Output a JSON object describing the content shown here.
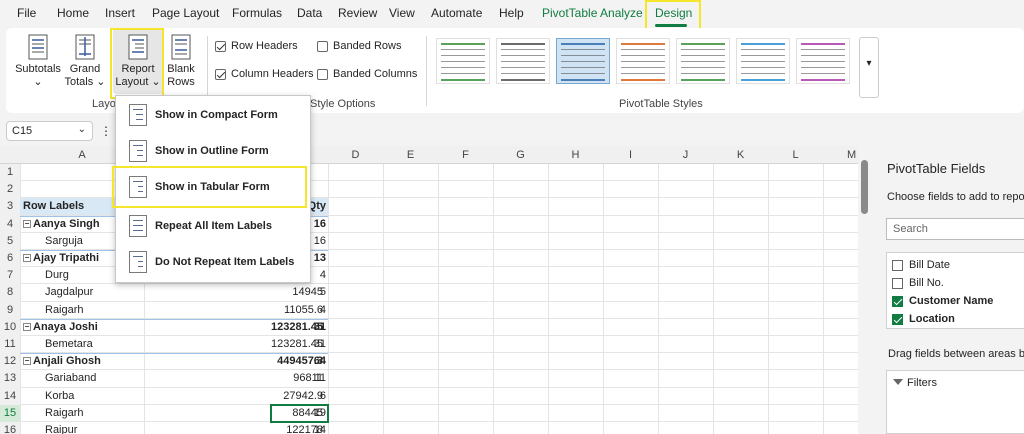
{
  "menu": {
    "tabs": [
      "File",
      "Home",
      "Insert",
      "Page Layout",
      "Formulas",
      "Data",
      "Review",
      "View",
      "Automate",
      "Help",
      "PivotTable Analyze",
      "Design"
    ]
  },
  "ribbon": {
    "subtotals": "Subtotals",
    "grand_totals_1": "Grand",
    "grand_totals_2": "Totals",
    "report_layout_1": "Report",
    "report_layout_2": "Layout",
    "blank_rows_1": "Blank",
    "blank_rows_2": "Rows",
    "layout_group": "Layo",
    "row_headers": "Row Headers",
    "column_headers": "Column Headers",
    "banded_rows": "Banded Rows",
    "banded_columns": "Banded Columns",
    "style_options_group": "Style Options",
    "styles_group": "PivotTable Styles",
    "style_colors": [
      "#5aa15a",
      "#6d6d6d",
      "#4a7fb8",
      "#e07a3c",
      "#5aa15a",
      "#4aa0d8",
      "#b85ab8"
    ]
  },
  "formula_bar": {
    "name_box": "C15"
  },
  "dropdown": {
    "items": [
      "Show in Compact Form",
      "Show in Outline Form",
      "Show in Tabular Form",
      "Repeat All Item Labels",
      "Do Not Repeat Item Labels"
    ]
  },
  "grid": {
    "columns": [
      "A",
      "D",
      "E",
      "F",
      "G",
      "H",
      "I",
      "J",
      "K",
      "L",
      "M"
    ],
    "rows": [
      "1",
      "2",
      "3",
      "4",
      "5",
      "6",
      "7",
      "8",
      "9",
      "10",
      "11",
      "12",
      "13",
      "14",
      "15",
      "16"
    ],
    "qty_header": "Qty",
    "row_labels_header": "Row Labels",
    "data": [
      {
        "label": "Aanya Singh",
        "bold": true,
        "amount": "",
        "qty": "16"
      },
      {
        "label": "Sarguja",
        "bold": false,
        "amount": "",
        "qty": "16"
      },
      {
        "label": "Ajay Tripathi",
        "bold": true,
        "amount": "",
        "qty": "13"
      },
      {
        "label": "Durg",
        "bold": false,
        "amount": "",
        "qty": "4"
      },
      {
        "label": "Jagdalpur",
        "bold": false,
        "amount": "14945",
        "qty": "5"
      },
      {
        "label": "Raigarh",
        "bold": false,
        "amount": "11055.6",
        "qty": "4"
      },
      {
        "label": "Anaya Joshi",
        "bold": true,
        "amount": "123281.45",
        "qty": "31"
      },
      {
        "label": "Bemetara",
        "bold": false,
        "amount": "123281.45",
        "qty": "31"
      },
      {
        "label": "Anjali Ghosh",
        "bold": true,
        "amount": "449457.3",
        "qty": "64"
      },
      {
        "label": "Gariaband",
        "bold": false,
        "amount": "96811",
        "qty": "11"
      },
      {
        "label": "Korba",
        "bold": false,
        "amount": "27942.9",
        "qty": "6"
      },
      {
        "label": "Raigarh",
        "bold": false,
        "amount": "88445",
        "qty": "19"
      },
      {
        "label": "Raipur",
        "bold": false,
        "amount": "122178",
        "qty": "14"
      }
    ]
  },
  "panel": {
    "title": "PivotTable Fields",
    "subtitle": "Choose fields to add to report:",
    "search_placeholder": "Search",
    "fields": [
      {
        "name": "Bill Date",
        "checked": false
      },
      {
        "name": "Bill No.",
        "checked": false
      },
      {
        "name": "Customer Name",
        "checked": true
      },
      {
        "name": "Location",
        "checked": true
      }
    ],
    "drag_hint": "Drag fields between areas below:",
    "filters": "Filters"
  }
}
